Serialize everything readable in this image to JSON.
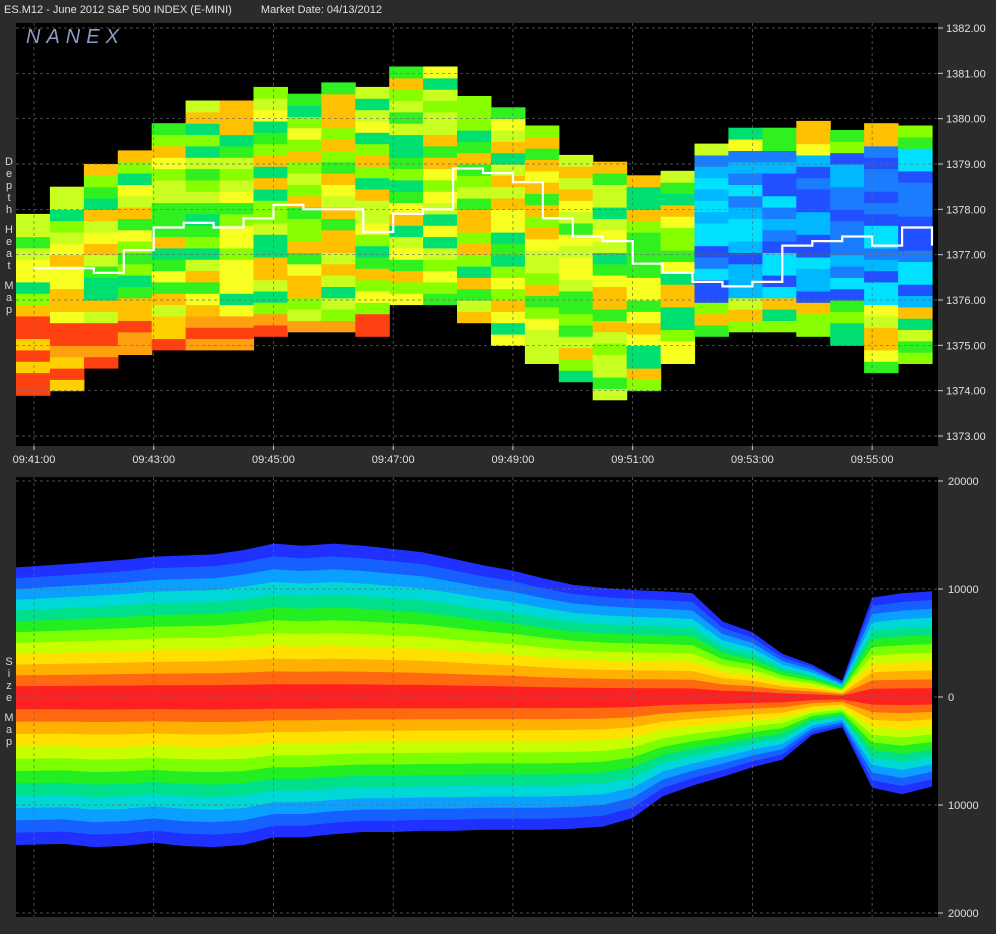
{
  "header": {
    "symbol": "ES.M12 - June 2012 S&P 500 INDEX (E-MINI)",
    "market_date": "Market Date: 04/13/2012"
  },
  "watermark": "NANEX",
  "chart_data": [
    {
      "type": "heatmap",
      "panel": "top",
      "ylabel": "Depth Heat Map",
      "x_ticks": [
        "09:41:00",
        "09:43:00",
        "09:45:00",
        "09:47:00",
        "09:49:00",
        "09:51:00",
        "09:53:00",
        "09:55:00"
      ],
      "y_ticks": [
        "1382.00",
        "1381.00",
        "1380.00",
        "1379.00",
        "1378.00",
        "1377.00",
        "1376.00",
        "1375.00",
        "1374.00",
        "1373.00"
      ],
      "ylim": [
        1373,
        1382
      ],
      "grid": true,
      "last_trade_series": {
        "color": "#ffffff",
        "x_minutes": [
          0,
          0.5,
          1,
          1.5,
          2,
          2.5,
          3,
          3.5,
          4,
          4.5,
          5,
          5.5,
          6,
          6.5,
          7,
          7.5,
          8,
          8.5,
          9,
          9.5,
          10,
          10.5,
          11,
          11.5,
          12,
          12.5,
          13,
          13.5,
          14,
          14.5,
          15
        ],
        "price": [
          1376.7,
          1376.7,
          1376.6,
          1377.1,
          1377.6,
          1377.7,
          1377.6,
          1377.8,
          1378.1,
          1378.0,
          1378.0,
          1377.5,
          1377.9,
          1378.0,
          1378.9,
          1378.8,
          1378.6,
          1377.8,
          1377.4,
          1377.3,
          1376.8,
          1376.6,
          1376.4,
          1376.3,
          1376.4,
          1377.2,
          1377.3,
          1377.4,
          1377.2,
          1377.6,
          1377.2
        ]
      },
      "depth_top": [
        1377.9,
        1378.6,
        1378.9,
        1379.4,
        1379.9,
        1380.3,
        1380.5,
        1380.7,
        1380.6,
        1380.7,
        1380.8,
        1381.2,
        1381.1,
        1380.6,
        1380.2,
        1379.8,
        1379.3,
        1379.0,
        1378.8,
        1378.9,
        1379.4,
        1379.8,
        1379.8,
        1380.0,
        1379.7,
        1379.9,
        1379.8
      ],
      "depth_bottom": [
        1373.9,
        1374.0,
        1374.5,
        1374.8,
        1374.9,
        1374.9,
        1374.9,
        1375.2,
        1375.3,
        1375.3,
        1375.2,
        1375.9,
        1375.9,
        1375.5,
        1375.0,
        1374.6,
        1374.2,
        1373.8,
        1374.0,
        1374.6,
        1375.2,
        1375.3,
        1375.3,
        1375.2,
        1375.0,
        1374.4,
        1374.6
      ]
    },
    {
      "type": "area",
      "panel": "bottom",
      "ylabel": "Size Map",
      "y_ticks": [
        "20000",
        "10000",
        "0",
        "10000",
        "20000"
      ],
      "ylim": [
        -20000,
        20000
      ],
      "grid": true,
      "x_minutes": [
        0,
        0.5,
        1,
        1.5,
        2,
        2.5,
        3,
        3.5,
        4,
        4.5,
        5,
        5.5,
        6,
        6.5,
        7,
        7.5,
        8,
        8.5,
        9,
        9.5,
        10,
        10.5,
        11,
        11.5,
        12,
        12.5,
        13,
        13.5,
        14,
        14.5,
        15
      ],
      "bid_size": [
        12000,
        12300,
        12500,
        12700,
        13000,
        13100,
        13200,
        13600,
        14200,
        14000,
        14200,
        14000,
        13700,
        13400,
        12800,
        12200,
        11700,
        11000,
        10400,
        10100,
        9900,
        9800,
        9600,
        7000,
        6000,
        4000,
        3000,
        1500,
        9200,
        9600,
        9800
      ],
      "ask_size": [
        -13700,
        -13600,
        -13900,
        -13800,
        -13500,
        -13800,
        -13900,
        -13700,
        -13000,
        -13000,
        -12700,
        -12500,
        -12500,
        -12400,
        -12400,
        -12300,
        -12300,
        -12300,
        -12200,
        -12000,
        -11200,
        -9200,
        -8200,
        -7400,
        -6500,
        -5800,
        -3500,
        -2800,
        -8400,
        -9000,
        -8300
      ],
      "color_bands": [
        "#ff2020",
        "#ff6a10",
        "#ffb000",
        "#ffe000",
        "#c8ff00",
        "#7cff00",
        "#22ee22",
        "#00e08a",
        "#00d8d8",
        "#0aa0ff",
        "#1660ff",
        "#2030ff"
      ]
    }
  ]
}
